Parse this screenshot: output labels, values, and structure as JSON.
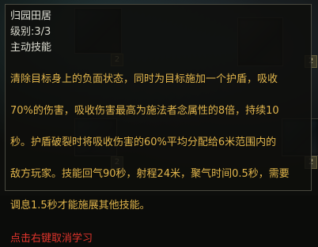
{
  "tooltip": {
    "skill_name": "归园田居",
    "level_label": "级别:3/3",
    "skill_type": "主动技能",
    "description_lines": [
      "清除目标身上的负面状态，同时为目标施加一个护盾，吸收",
      "70%的伤害，吸收伤害最高为施法者念属性的8倍，持续10",
      "秒。护盾破裂时将吸收伤害的60%平均分配给6米范围内的",
      "敌方玩家。技能回气90秒，射程24米，聚气时间0.5秒，需要",
      "调息1.5秒才能施展其他技能。"
    ],
    "action_hint": "点击右键取消学习"
  },
  "background_slots": {
    "badge_a": "2",
    "badge_b": "2",
    "badge_c": "2",
    "badge_d": "2"
  },
  "colors": {
    "description": "#e2b64c",
    "action_hint": "#e0342c",
    "default_text": "#dcdcd2"
  }
}
